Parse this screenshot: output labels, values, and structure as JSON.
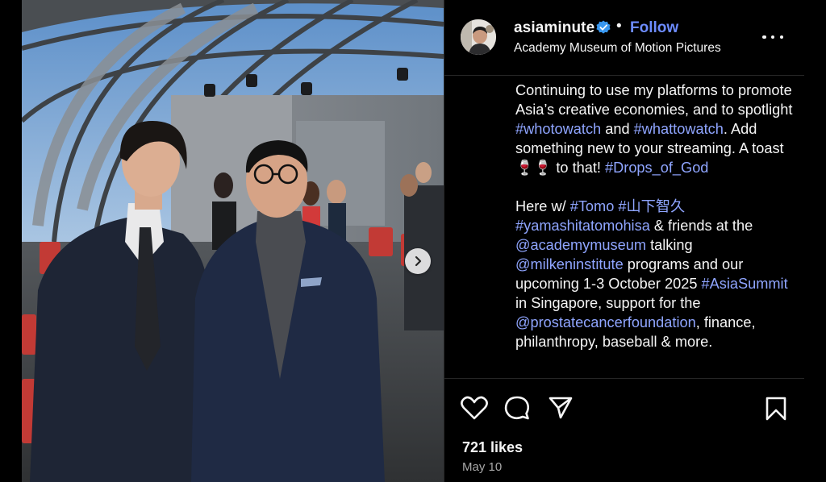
{
  "post": {
    "username": "asiaminute",
    "dot": "•",
    "follow_label": "Follow",
    "location": "Academy Museum of Motion Pictures",
    "caption": {
      "p1": [
        {
          "t": "Continuing to use my platforms to promote Asia’s creative economies, and to spotlight "
        },
        {
          "t": "#whotowatch",
          "tag": true
        },
        {
          "t": " and "
        },
        {
          "t": "#whattowatch",
          "tag": true
        },
        {
          "t": ". Add something new to your streaming. A toast 🍷🍷 to that! "
        },
        {
          "t": "#Drops_of_God",
          "tag": true
        }
      ],
      "p2": [
        {
          "t": "Here w/ "
        },
        {
          "t": "#Tomo",
          "tag": true
        },
        {
          "t": " "
        },
        {
          "t": "#山下智久",
          "tag": true
        },
        {
          "t": " "
        },
        {
          "t": "#yamashitatomohisa",
          "tag": true
        },
        {
          "t": " & friends at the "
        },
        {
          "t": "@academymuseum",
          "tag": true
        },
        {
          "t": " talking "
        },
        {
          "t": "@milkeninstitute",
          "tag": true
        },
        {
          "t": " programs and our upcoming 1-3 October 2025 "
        },
        {
          "t": "#AsiaSummit",
          "tag": true
        },
        {
          "t": " in Singapore, support for the "
        },
        {
          "t": "@prostatecancerfoundation",
          "tag": true
        },
        {
          "t": ", finance, philanthropy, baseball & more."
        }
      ]
    },
    "likes_text": "721 likes",
    "date_text": "May 10"
  },
  "icons": {
    "verified": "verified-badge-icon",
    "more": "more-options-icon",
    "like": "heart-icon",
    "comment": "comment-bubble-icon",
    "share": "send-paper-plane-icon",
    "save": "bookmark-icon",
    "next": "chevron-right-icon"
  },
  "colors": {
    "background": "#000000",
    "text": "#f5f5f5",
    "link": "#8fa5ff",
    "follow": "#6d8cff",
    "verified": "#3897f0",
    "muted": "#a8a8a8",
    "divider": "#262626"
  }
}
